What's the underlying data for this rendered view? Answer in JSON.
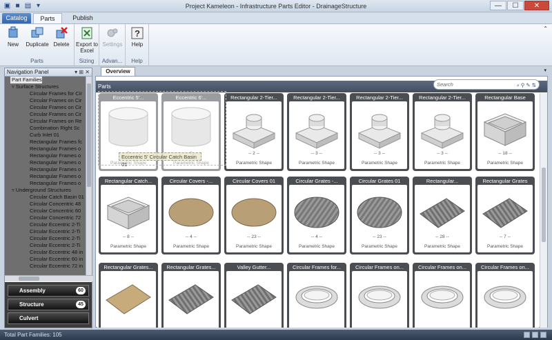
{
  "window": {
    "title": "Project Kameleon - Infrastructure Parts Editor - DrainageStructure",
    "min_label": "—",
    "max_label": "☐",
    "close_label": "✕"
  },
  "tabs": {
    "catalog": "Catalog",
    "parts": "Parts",
    "publish": "Publish"
  },
  "ribbon": {
    "new": "New",
    "duplicate": "Duplicate",
    "delete": "Delete",
    "parts_group": "Parts",
    "export": "Export to Excel",
    "sizing_group": "Sizing",
    "settings": "Settings",
    "advanced_group": "Advan...",
    "help": "Help",
    "help_group": "Help"
  },
  "nav": {
    "title": "Navigation Panel",
    "header_buttons": "▾ ⊞ ✕",
    "root": "Part Families",
    "tree": [
      {
        "level": 1,
        "label": "Surface Structures"
      },
      {
        "level": 2,
        "label": "Circular Frames for Cir"
      },
      {
        "level": 2,
        "label": "Circular Frames on Cir"
      },
      {
        "level": 2,
        "label": "Circular Frames on Cir"
      },
      {
        "level": 2,
        "label": "Circular Frames on Cir"
      },
      {
        "level": 2,
        "label": "Circular Frames on Re"
      },
      {
        "level": 2,
        "label": "Combination Right Sc"
      },
      {
        "level": 2,
        "label": "Curb Inlet 01"
      },
      {
        "level": 2,
        "label": "Rectangular Frames fc"
      },
      {
        "level": 2,
        "label": "Rectangular Frames o"
      },
      {
        "level": 2,
        "label": "Rectangular Frames o"
      },
      {
        "level": 2,
        "label": "Rectangular Frames o"
      },
      {
        "level": 2,
        "label": "Rectangular Frames o"
      },
      {
        "level": 2,
        "label": "Rectangular Frames o"
      },
      {
        "level": 2,
        "label": "Rectangular Frames o"
      },
      {
        "level": 1,
        "label": "Underground Structures"
      },
      {
        "level": 2,
        "label": "Circular Catch Basin 01"
      },
      {
        "level": 2,
        "label": "Circular Concentric 48"
      },
      {
        "level": 2,
        "label": "Circular Concentric 60"
      },
      {
        "level": 2,
        "label": "Circular Concentric 72"
      },
      {
        "level": 2,
        "label": "Circular Eccentric 2-Ti"
      },
      {
        "level": 2,
        "label": "Circular Eccentric 2-Ti"
      },
      {
        "level": 2,
        "label": "Circular Eccentric 2-Ti"
      },
      {
        "level": 2,
        "label": "Circular Eccentric 2-Ti"
      },
      {
        "level": 2,
        "label": "Circular Eccentric 48 in"
      },
      {
        "level": 2,
        "label": "Circular Eccentric 60 in"
      },
      {
        "level": 2,
        "label": "Circular Eccentric 72 in"
      }
    ],
    "buttons": [
      {
        "label": "Assembly",
        "count": "60"
      },
      {
        "label": "Structure",
        "count": "45"
      },
      {
        "label": "Culvert",
        "count": ""
      }
    ]
  },
  "main": {
    "tab": "Overview",
    "section": "Parts",
    "search_placeholder": "Search",
    "tooltip": "Eccentric 5' Circular Catch Basin 01",
    "cards": [
      {
        "title": "Eccentric 5'...",
        "count": "-- 8 --",
        "type": "Parametric Shape",
        "shape": "cyl",
        "ghost": true
      },
      {
        "title": "Eccentric 6'...",
        "count": "-- 8 --",
        "type": "Parametric Shape",
        "shape": "cyl",
        "ghost": true
      },
      {
        "title": "Rectangular 2-Tier...",
        "count": "-- 2 --",
        "type": "Parametric Shape",
        "shape": "rect2"
      },
      {
        "title": "Rectangular 2-Tier...",
        "count": "-- 3 --",
        "type": "Parametric Shape",
        "shape": "rect2"
      },
      {
        "title": "Rectangular 2-Tier...",
        "count": "-- 3 --",
        "type": "Parametric Shape",
        "shape": "rect2"
      },
      {
        "title": "Rectangular 2-Tier...",
        "count": "-- 3 --",
        "type": "Parametric Shape",
        "shape": "rect2"
      },
      {
        "title": "Rectangular Base",
        "count": "-- 18 --",
        "type": "Parametric Shape",
        "shape": "box"
      },
      {
        "title": "Rectangular Catch...",
        "count": "-- 8 --",
        "type": "Parametric Shape",
        "shape": "box"
      },
      {
        "title": "Circular Covers -...",
        "count": "-- 4 --",
        "type": "Parametric Shape",
        "shape": "disc"
      },
      {
        "title": "Circular Covers 01",
        "count": "-- 23 --",
        "type": "Parametric Shape",
        "shape": "disc"
      },
      {
        "title": "Circular Grates -...",
        "count": "-- 4 --",
        "type": "Parametric Shape",
        "shape": "grate"
      },
      {
        "title": "Circular Grates 01",
        "count": "-- 23 --",
        "type": "Parametric Shape",
        "shape": "grate"
      },
      {
        "title": "Rectangular...",
        "count": "-- 28 --",
        "type": "Parametric Shape",
        "shape": "rgrate"
      },
      {
        "title": "Rectangular Grates",
        "count": "-- 7 --",
        "type": "Parametric Shape",
        "shape": "rgrate"
      },
      {
        "title": "Rectangular Grates...",
        "count": "",
        "type": "",
        "shape": "plate"
      },
      {
        "title": "Rectangular Grates...",
        "count": "",
        "type": "",
        "shape": "rgrate"
      },
      {
        "title": "Valley Gutter...",
        "count": "",
        "type": "",
        "shape": "rgrate"
      },
      {
        "title": "Circular Frames for...",
        "count": "",
        "type": "",
        "shape": "ring"
      },
      {
        "title": "Circular Frames on...",
        "count": "",
        "type": "",
        "shape": "ring"
      },
      {
        "title": "Circular Frames on...",
        "count": "",
        "type": "",
        "shape": "ring"
      },
      {
        "title": "Circular Frames on...",
        "count": "",
        "type": "",
        "shape": "ring"
      }
    ]
  },
  "status": {
    "text": "Total Part Families: 105"
  }
}
